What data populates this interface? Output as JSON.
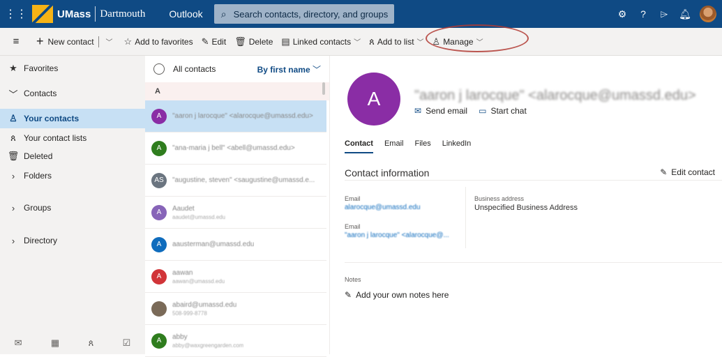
{
  "brand": {
    "name": "UMass",
    "sub": "Dartmouth"
  },
  "app_name": "Outlook",
  "search": {
    "placeholder": "Search contacts, directory, and groups"
  },
  "toolbar": {
    "new_contact": "New contact",
    "add_favorites": "Add to favorites",
    "edit": "Edit",
    "delete": "Delete",
    "linked_contacts": "Linked contacts",
    "add_to_list": "Add to list",
    "manage": "Manage"
  },
  "sidebar": {
    "favorites": "Favorites",
    "contacts": "Contacts",
    "your_contacts": "Your contacts",
    "your_contact_lists": "Your contact lists",
    "deleted": "Deleted",
    "folders": "Folders",
    "groups": "Groups",
    "directory": "Directory"
  },
  "list": {
    "header": "All contacts",
    "sort": "By first name",
    "letter": "A",
    "rows": [
      {
        "initials": "A",
        "color": "#8a2da5",
        "line1": "\"aaron j larocque\" <alarocque@umassd.edu>",
        "line2": "",
        "selected": true
      },
      {
        "initials": "A",
        "color": "#2f7d1e",
        "line1": "\"ana-maria j bell\" <abell@umassd.edu>",
        "line2": ""
      },
      {
        "initials": "AS",
        "color": "#6b7580",
        "line1": "\"augustine, steven\" <saugustine@umassd.e...",
        "line2": ""
      },
      {
        "initials": "A",
        "color": "#8764b8",
        "line1": "Aaudet",
        "line2": "aaudet@umassd.edu"
      },
      {
        "initials": "A",
        "color": "#0f6cbd",
        "line1": "aausterman@umassd.edu",
        "line2": ""
      },
      {
        "initials": "A",
        "color": "#d13438",
        "line1": "aawan",
        "line2": "aawan@umassd.edu"
      },
      {
        "initials": "",
        "color": "#7a6a58",
        "line1": "abaird@umassd.edu",
        "line2": "508-999-8778"
      },
      {
        "initials": "A",
        "color": "#2f7d1e",
        "line1": "abby",
        "line2": "abby@waxgreengarden.com"
      }
    ]
  },
  "detail": {
    "initials": "A",
    "display_name": "\"aaron j larocque\" <alarocque@umassd.edu>",
    "send_email": "Send email",
    "start_chat": "Start chat",
    "tabs": [
      "Contact",
      "Email",
      "Files",
      "LinkedIn"
    ],
    "section_title": "Contact information",
    "edit_contact": "Edit contact",
    "email_label_1": "Email",
    "email_value_1": "alarocque@umassd.edu",
    "email_label_2": "Email",
    "email_value_2": "\"aaron j larocque\" <alarocque@...",
    "business_address_label": "Business address",
    "business_address_value": "Unspecified Business Address",
    "notes_label": "Notes",
    "notes_add": "Add your own notes here"
  },
  "colors": {
    "header": "#0f4a84",
    "selected": "#c7e0f4",
    "annotation": "#b03a32"
  }
}
